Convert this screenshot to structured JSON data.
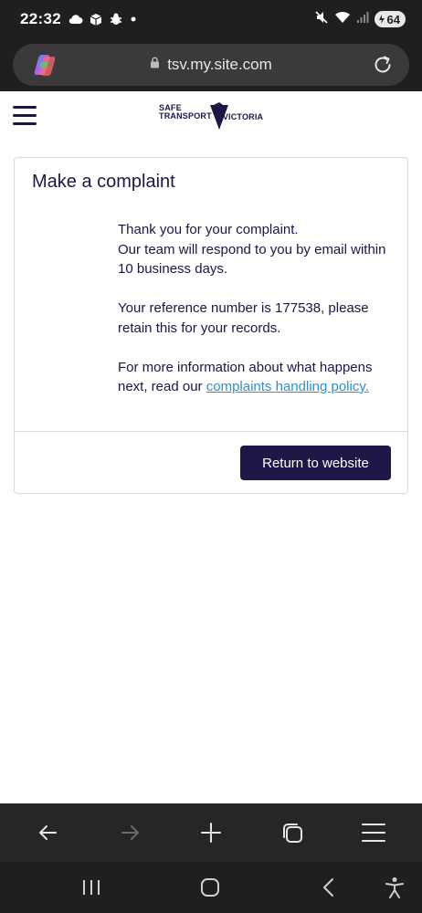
{
  "status_bar": {
    "time": "22:32",
    "battery": "64",
    "left_icons": [
      "cloud-icon",
      "files-icon",
      "bug-icon",
      "dot-icon"
    ],
    "right_icons": [
      "mute-icon",
      "wifi-icon",
      "signal-icon",
      "battery-icon"
    ]
  },
  "browser": {
    "url": "tsv.my.site.com",
    "icons": [
      "copilot-icon",
      "lock-icon",
      "reload-icon"
    ]
  },
  "site": {
    "logo": {
      "line1": "SAFE",
      "line2": "TRANSPORT",
      "line3": "VICTORIA"
    }
  },
  "card": {
    "title": "Make a complaint",
    "para1_line1": "Thank you for your complaint.",
    "para1_line2": "Our team will respond to you by email within 10 business days.",
    "para2": "Your reference number is 177538, please retain this for your records.",
    "para3_prefix": "For more information about what happens next, read our ",
    "policy_link": "complaints handling policy.",
    "return_button": "Return to website"
  },
  "toolbar": {
    "items": [
      "back-icon",
      "forward-icon",
      "new-tab-icon",
      "tabs-icon",
      "menu-icon"
    ]
  },
  "nav_bar": {
    "items": [
      "recents-icon",
      "home-icon",
      "back-icon",
      "accessibility-icon"
    ]
  },
  "colors": {
    "brand_navy": "#1a1745",
    "button_bg": "#1f1748",
    "link": "#2f8fcf",
    "chrome_dark": "#1f1f1f"
  }
}
